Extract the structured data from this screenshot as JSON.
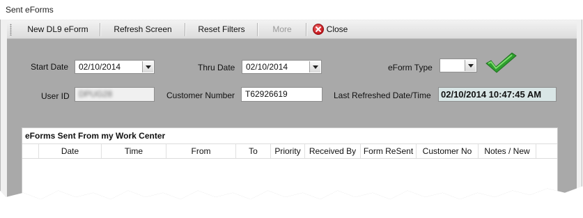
{
  "window": {
    "title": "Sent eForms"
  },
  "toolbar": {
    "new_label": "New DL9 eForm",
    "refresh_label": "Refresh Screen",
    "reset_label": "Reset Filters",
    "more_label": "More",
    "close_label": "Close"
  },
  "filters": {
    "start_date_label": "Start Date",
    "start_date_value": "02/10/2014",
    "thru_date_label": "Thru Date",
    "thru_date_value": "02/10/2014",
    "eform_type_label": "eForm Type",
    "eform_type_value": "",
    "user_id_label": "User ID",
    "user_id_value": "DPUG28",
    "customer_number_label": "Customer Number",
    "customer_number_value": "T62926619",
    "last_refreshed_label": "Last Refreshed Date/Time",
    "last_refreshed_value": "02/10/2014 10:47:45 AM"
  },
  "grid": {
    "title": "eForms Sent From my Work Center",
    "columns": [
      "Date",
      "Time",
      "From",
      "To",
      "Priority",
      "Received By",
      "Form ReSent",
      "Customer No",
      "Notes / New"
    ]
  },
  "colors": {
    "client_background": "#a9a9a9",
    "checkmark": "#2e9e2e",
    "close_icon": "#c4161c"
  },
  "icons": [
    "close-icon",
    "checkmark-icon",
    "dropdown-arrow-icon"
  ]
}
